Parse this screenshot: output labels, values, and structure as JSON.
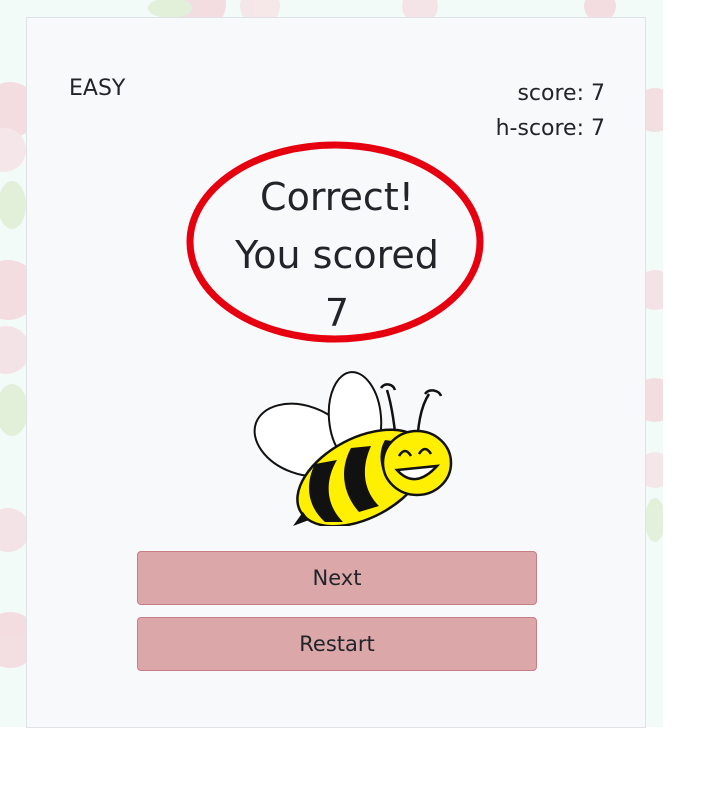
{
  "game": {
    "difficulty": "EASY",
    "score_text": "score: 7",
    "high_score_text": "h-score: 7"
  },
  "result": {
    "line1": "Correct!",
    "line2": "You scored",
    "line3": "7"
  },
  "buttons": {
    "next_label": "Next",
    "restart_label": "Restart"
  },
  "colors": {
    "card_background": "#f8f9fa",
    "button_background": "#dca7a9",
    "button_border": "#c97e86",
    "highlight_ring": "#e6000f",
    "bee_yellow": "#ffef00"
  },
  "icons": {
    "mascot": "bee-icon",
    "annotation": "highlight-ring"
  }
}
